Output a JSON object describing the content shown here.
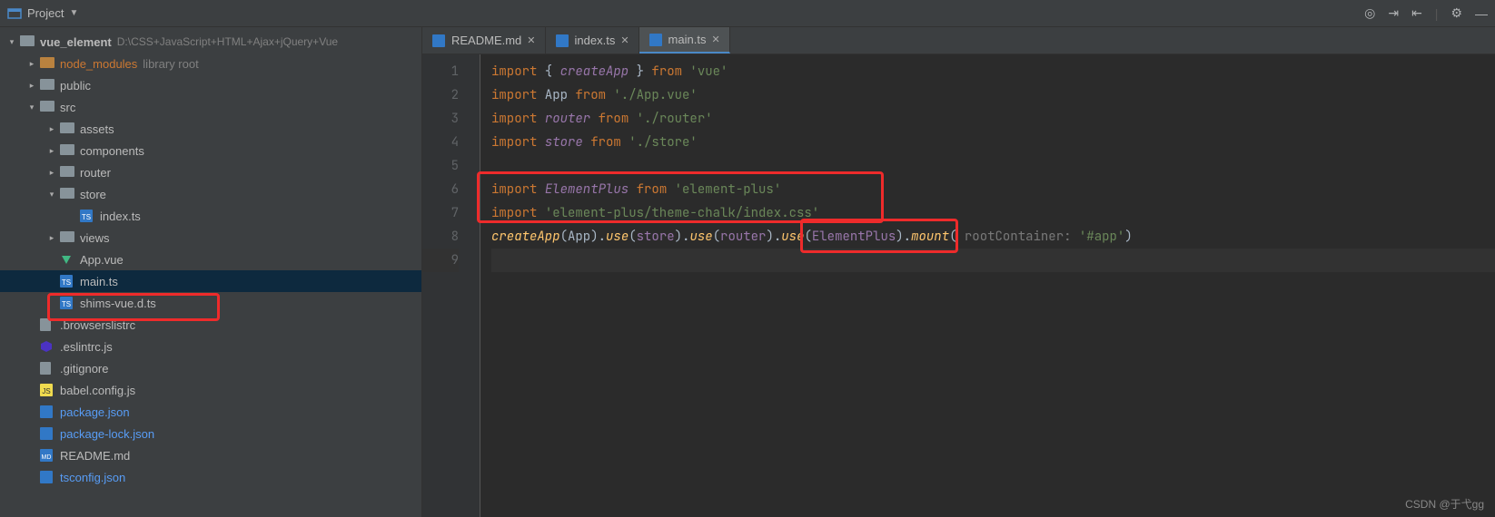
{
  "header": {
    "project_label": "Project"
  },
  "tree": {
    "root": {
      "name": "vue_element",
      "path": "D:\\CSS+JavaScript+HTML+Ajax+jQuery+Vue"
    },
    "node_modules": {
      "name": "node_modules",
      "lib": "library root"
    },
    "public": "public",
    "src": "src",
    "assets": "assets",
    "components": "components",
    "router": "router",
    "store": "store",
    "index_ts": "index.ts",
    "views": "views",
    "app_vue": "App.vue",
    "main_ts": "main.ts",
    "shims": "shims-vue.d.ts",
    "browserslist": ".browserslistrc",
    "eslint": ".eslintrc.js",
    "gitignore": ".gitignore",
    "babel": "babel.config.js",
    "pkg": "package.json",
    "pkglock": "package-lock.json",
    "readme": "README.md",
    "tsconfig": "tsconfig.json"
  },
  "tabs": {
    "readme": "README.md",
    "index": "index.ts",
    "main": "main.ts"
  },
  "code": {
    "l1_import": "import",
    "l1_open": " { ",
    "l1_id": "createApp",
    "l1_close": " } ",
    "l1_from": "from ",
    "l1_str": "'vue'",
    "l2_import": "import",
    "l2_name": " App ",
    "l2_from": "from ",
    "l2_str": "'./App.vue'",
    "l3_import": "import",
    "l3_sp": " ",
    "l3_id": "router",
    "l3_from": " from ",
    "l3_str": "'./router'",
    "l4_import": "import",
    "l4_sp": " ",
    "l4_id": "store",
    "l4_from": " from ",
    "l4_str": "'./store'",
    "l6_import": "import",
    "l6_sp": " ",
    "l6_id": "ElementPlus",
    "l6_from": " from ",
    "l6_str": "'element-plus'",
    "l7_import": "import",
    "l7_sp": " ",
    "l7_str": "'element-plus/theme-chalk/index.css'",
    "l8_fn": "createApp",
    "l8_p1": "(App).",
    "l8_use1": "use",
    "l8_p2": "(",
    "l8_store": "store",
    "l8_p3": ").",
    "l8_use2": "use",
    "l8_p4": "(",
    "l8_router": "router",
    "l8_p5": ").",
    "l8_use3": "use",
    "l8_p6": "(",
    "l8_ep": "ElementPlus",
    "l8_p7": ").",
    "l8_mount": "mount",
    "l8_p8": "(",
    "l8_hint": " rootContainer: ",
    "l8_str": "'#app'",
    "l8_p9": ")"
  },
  "line_numbers": [
    "1",
    "2",
    "3",
    "4",
    "5",
    "6",
    "7",
    "8",
    "9"
  ],
  "watermark": "CSDN @于弋gg"
}
